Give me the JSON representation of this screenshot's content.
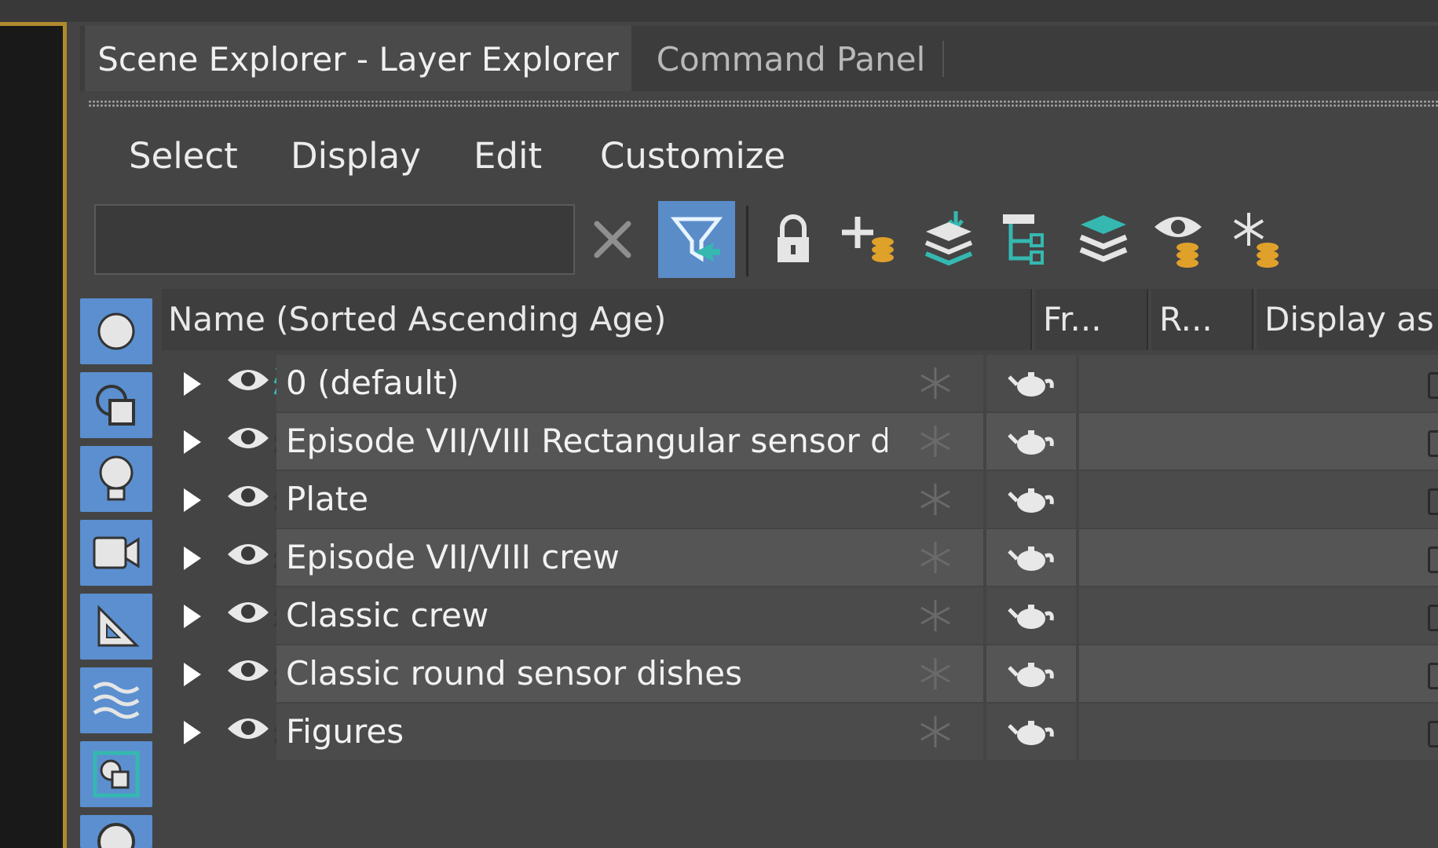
{
  "tabs": [
    {
      "label": "Scene Explorer - Layer Explorer",
      "active": true
    },
    {
      "label": "Command Panel",
      "active": false
    }
  ],
  "menu": [
    "Select",
    "Display",
    "Edit",
    "Customize"
  ],
  "search": {
    "value": "",
    "placeholder": ""
  },
  "toolbar_icons": [
    "clear-icon",
    "filter-select-icon",
    "lock-icon",
    "add-layer-icon",
    "move-to-layer-icon",
    "layer-hierarchy-icon",
    "layers-icon",
    "visibility-layer-icon",
    "freeze-layer-icon"
  ],
  "sidebar_icons": [
    "geometry-filter-icon",
    "shapes-filter-icon",
    "lights-filter-icon",
    "cameras-filter-icon",
    "helpers-filter-icon",
    "spacewarps-filter-icon",
    "groups-filter-icon",
    "bones-filter-icon"
  ],
  "columns": {
    "name": "Name (Sorted Ascending Age)",
    "freeze": "Fr...",
    "render": "R...",
    "display": "Display as I"
  },
  "rows": [
    {
      "label": "0 (default)",
      "active_layer": true
    },
    {
      "label": "Episode VII/VIII Rectangular sensor dishes",
      "active_layer": false
    },
    {
      "label": "Plate",
      "active_layer": false
    },
    {
      "label": "Episode VII/VIII crew",
      "active_layer": false
    },
    {
      "label": "Classic crew",
      "active_layer": false
    },
    {
      "label": "Classic round sensor dishes",
      "active_layer": false
    },
    {
      "label": "Figures",
      "active_layer": false
    }
  ],
  "colors": {
    "accent_blue": "#5a8cc8",
    "layer_teal": "#35b8b0",
    "gold": "#b08a2e",
    "coin_yellow": "#e0a12a"
  }
}
